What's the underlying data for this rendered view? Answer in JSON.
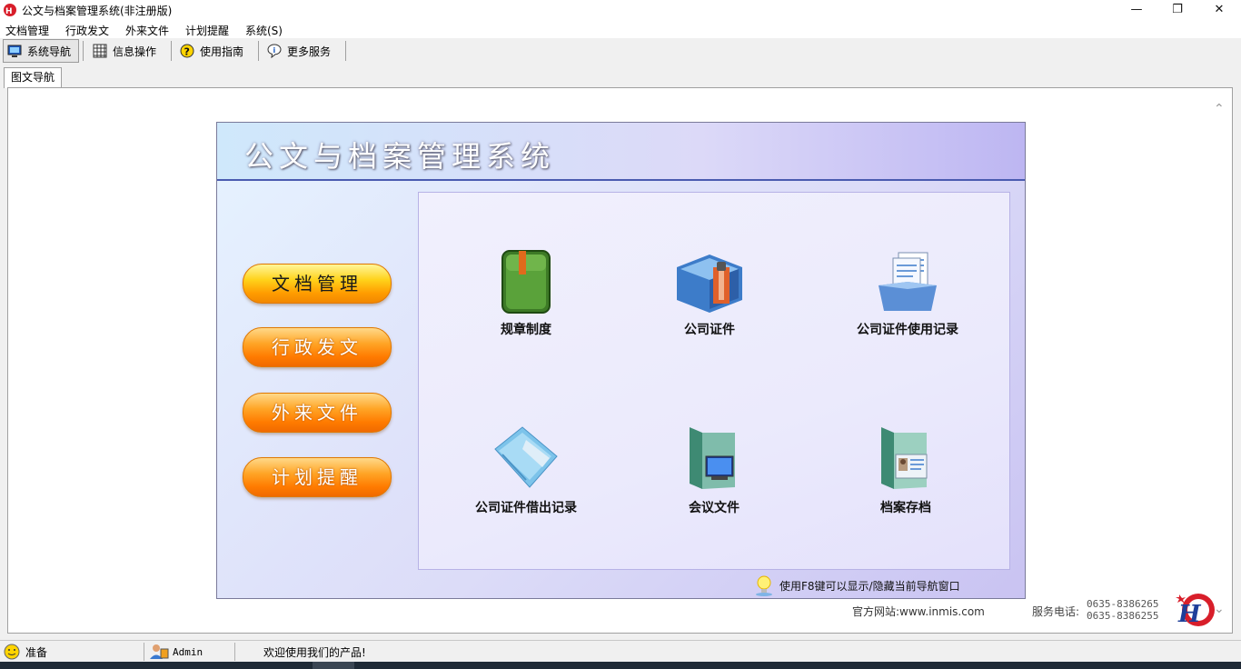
{
  "window": {
    "title": "公文与档案管理系统(非注册版)",
    "controls": {
      "minimize": "—",
      "restore": "❐",
      "close": "✕"
    }
  },
  "menu": [
    "文档管理",
    "行政发文",
    "外来文件",
    "计划提醒",
    "系统(S)"
  ],
  "toolbar": [
    {
      "label": "系统导航",
      "icon": "monitor-icon",
      "active": true
    },
    {
      "label": "信息操作",
      "icon": "grid-icon",
      "active": false
    },
    {
      "label": "使用指南",
      "icon": "help-icon",
      "active": false
    },
    {
      "label": "更多服务",
      "icon": "info-icon",
      "active": false
    }
  ],
  "tab": {
    "label": "图文导航"
  },
  "panel": {
    "title": "公文与档案管理系统",
    "side_buttons": [
      "文档管理",
      "行政发文",
      "外来文件",
      "计划提醒"
    ],
    "tiles": [
      {
        "label": "规章制度",
        "icon": "green-book-icon"
      },
      {
        "label": "公司证件",
        "icon": "folder-zipper-icon"
      },
      {
        "label": "公司证件使用记录",
        "icon": "folder-documents-icon"
      },
      {
        "label": "公司证件借出记录",
        "icon": "blue-folder-icon"
      },
      {
        "label": "会议文件",
        "icon": "monitor-folder-icon"
      },
      {
        "label": "档案存档",
        "icon": "contact-card-icon"
      }
    ],
    "hint": "使用F8键可以显示/隐藏当前导航窗口"
  },
  "footer": {
    "website": "官方网站:www.inmis.com",
    "phone_label": "服务电话:",
    "phones": [
      "0635-8386265",
      "0635-8386255"
    ]
  },
  "status": {
    "ready": "准备",
    "user": "Admin",
    "message": "欢迎使用我们的产品!"
  },
  "colors": {
    "accent_blue": "#4a5bb0",
    "button_yellow": "#ffd21a",
    "button_orange": "#ff7b00",
    "logo_red": "#d81e2a",
    "logo_blue": "#1f3f9a"
  }
}
